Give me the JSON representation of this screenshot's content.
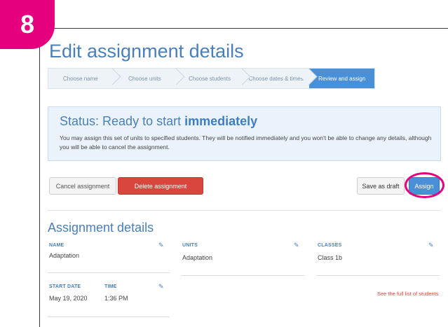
{
  "badge": {
    "step_number": "8"
  },
  "page": {
    "title": "Edit assignment details"
  },
  "steps": [
    {
      "label": "Choose name",
      "active": false
    },
    {
      "label": "Choose units",
      "active": false
    },
    {
      "label": "Choose students",
      "active": false
    },
    {
      "label": "Choose dates & times",
      "active": false
    },
    {
      "label": "Review and assign",
      "active": true
    }
  ],
  "status": {
    "prefix": "Status: Ready to start ",
    "emphasis": "immediately",
    "message": "You may assign this set of units to specified students. They will be notified immediately and you won't be able to change any details, although you will be able to cancel the assignment."
  },
  "actions": {
    "cancel_label": "Cancel assignment",
    "delete_label": "Delete assignment",
    "draft_label": "Save as draft",
    "assign_label": "Assign"
  },
  "details": {
    "title": "Assignment details",
    "name_label": "NAME",
    "name_value": "Adaptation",
    "units_label": "UNITS",
    "units_value": "Adaptation",
    "classes_label": "CLASSES",
    "classes_value": "Class 1b",
    "start_date_label": "START DATE",
    "start_date_value": "May 19, 2020",
    "time_label": "TIME",
    "time_value": "1:36 PM",
    "students_link": "See the full list of students"
  },
  "icons": {
    "edit": "pencil-icon"
  },
  "colors": {
    "accent": "#4a90d9",
    "danger": "#d9463e",
    "highlight": "#e5007e"
  }
}
